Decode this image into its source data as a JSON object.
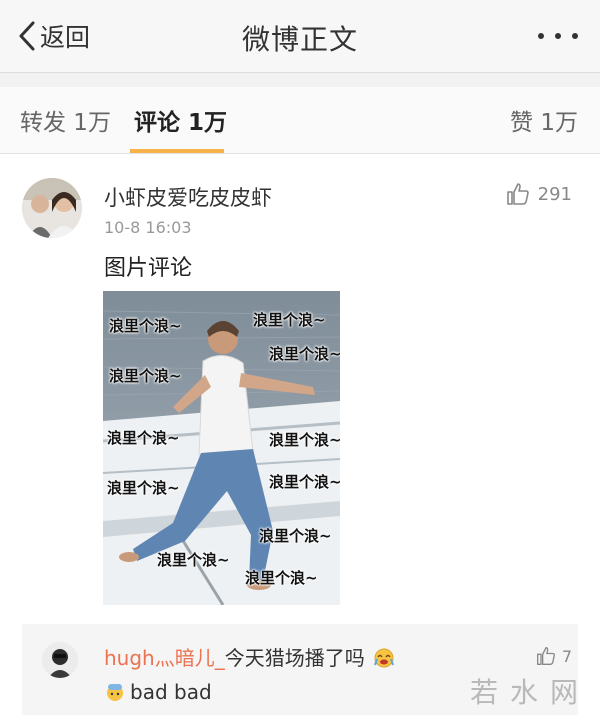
{
  "nav": {
    "back_label": "返回",
    "title": "微博正文",
    "more_icon": "more-dots-icon"
  },
  "tabs": {
    "repost": "转发 1万",
    "comment": "评论 1万",
    "like": "赞 1万",
    "active_color": "#f7b34a"
  },
  "comment": {
    "username": "小虾皮爱吃皮皮虾",
    "timestamp": "10-8 16:03",
    "like_count": "291",
    "text": "图片评论",
    "image_overlay_text": "浪里个浪~"
  },
  "reply": {
    "username": "hugh灬暗儿_",
    "text": "今天猎场播了吗",
    "sub_text": "bad bad",
    "like_count": "7",
    "username_color": "#eb7350"
  },
  "watermark": "若水网"
}
